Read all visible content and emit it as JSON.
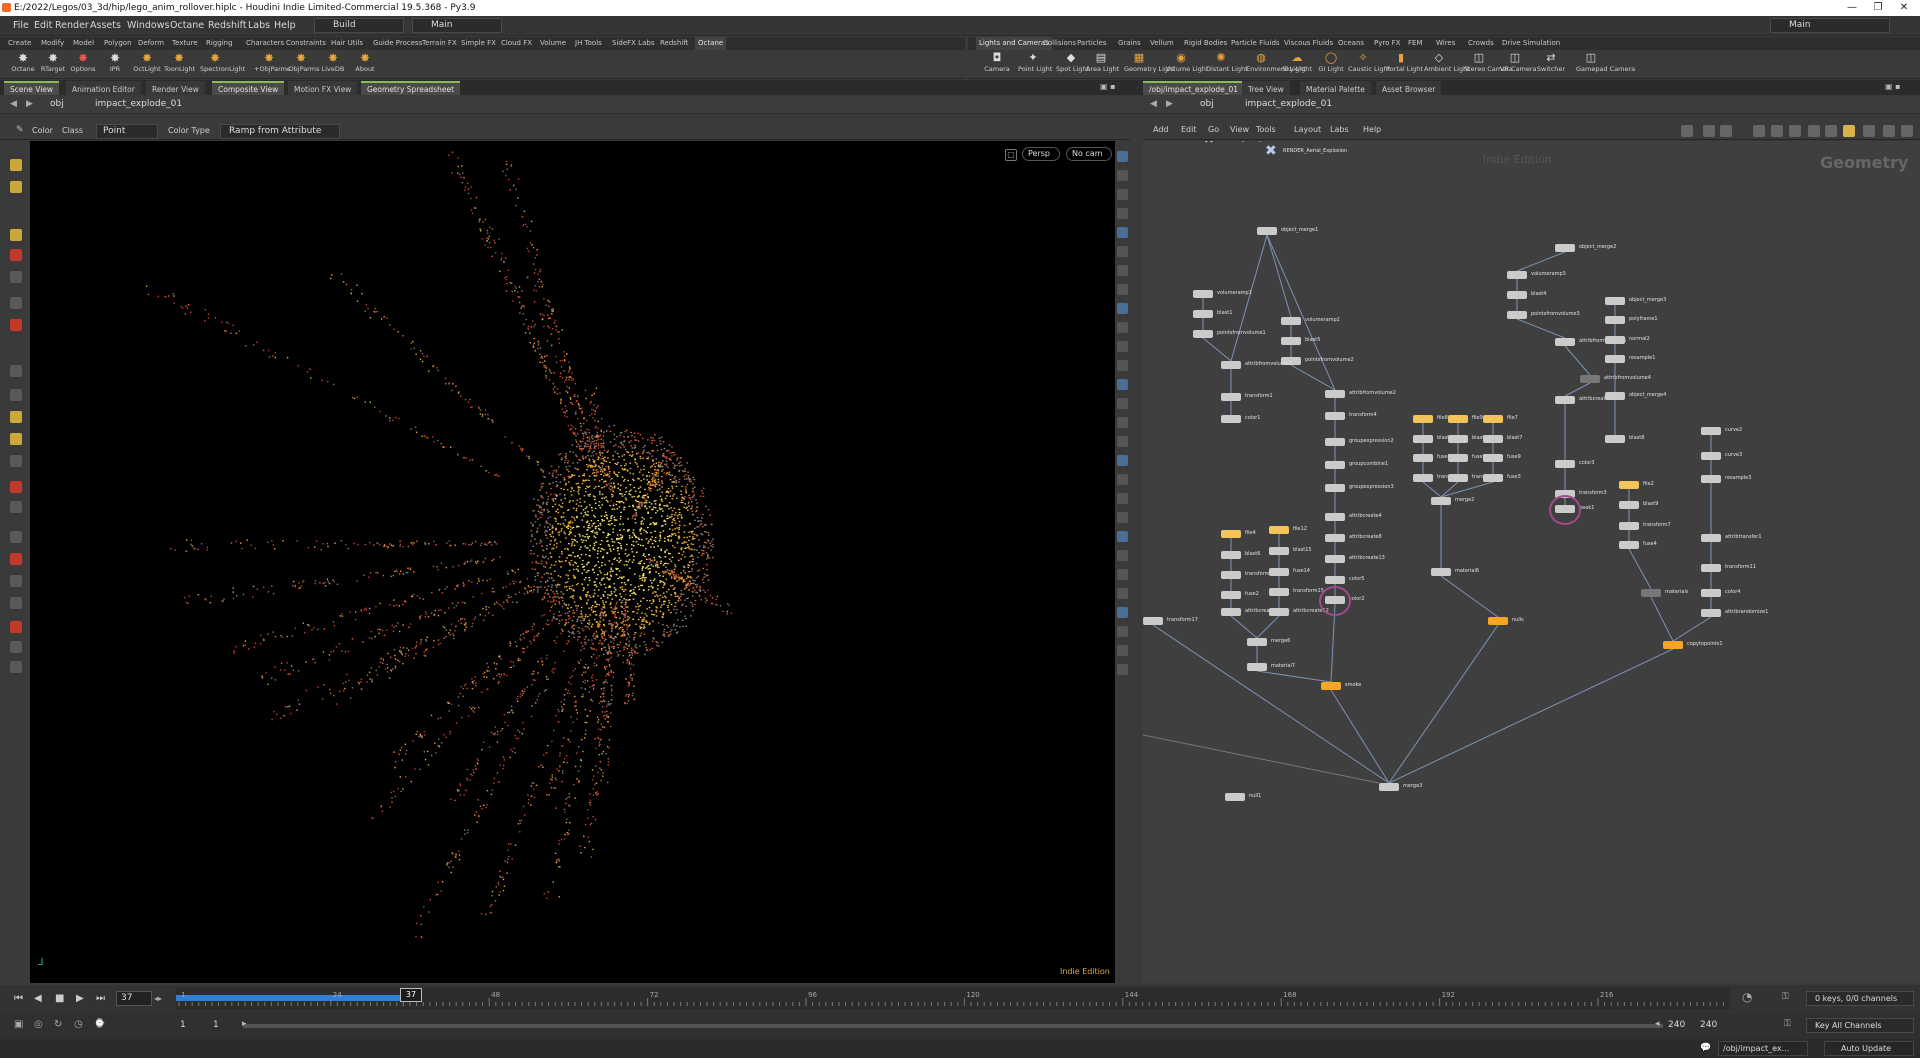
{
  "title_bar": {
    "text": "E:/2022/Legos/03_3d/hip/lego_anim_rollover.hiplc - Houdini Indie Limited-Commercial 19.5.368 - Py3.9",
    "minimize": "—",
    "restore": "❐",
    "close": "✕"
  },
  "menu": {
    "items": [
      "File",
      "Edit",
      "Render",
      "Assets",
      "Windows",
      "Octane",
      "Redshift",
      "Labs",
      "Help"
    ],
    "desktop": "Build",
    "context": "Main",
    "right_context": "Main"
  },
  "shelf_tabs_left": [
    "Create",
    "Modify",
    "Model",
    "Polygon",
    "Deform",
    "Texture",
    "Rigging",
    "Characters",
    "Constraints",
    "Hair Utils",
    "Guide Process",
    "Terrain FX",
    "Simple FX",
    "Cloud FX",
    "Volume",
    "JH Tools",
    "SideFX Labs",
    "Redshift",
    "Octane"
  ],
  "shelf_tabs_right": [
    "Lights and Cameras",
    "Collisions",
    "Particles",
    "Grains",
    "Vellum",
    "Rigid Bodies",
    "Particle Fluids",
    "Viscous Fluids",
    "Oceans",
    "Pyro FX",
    "FEM",
    "Wires",
    "Crowds",
    "Drive Simulation"
  ],
  "shelf_tools_left": [
    {
      "label": "Octane",
      "icon": "octane-icon"
    },
    {
      "label": "RTarget",
      "icon": "rtarget-icon"
    },
    {
      "label": "Options",
      "icon": "options-icon"
    },
    {
      "label": "IPR",
      "icon": "ipr-icon"
    },
    {
      "label": "OctLight",
      "icon": "octlight-icon"
    },
    {
      "label": "ToonLight",
      "icon": "toonlight-icon"
    },
    {
      "label": "SpectronLight",
      "icon": "spectronlight-icon"
    },
    {
      "label": "+ObjParms",
      "icon": "add-objparms-icon"
    },
    {
      "label": "-ObjParms",
      "icon": "remove-objparms-icon"
    },
    {
      "label": "LiveDB",
      "icon": "livedb-icon"
    },
    {
      "label": "About",
      "icon": "about-icon"
    }
  ],
  "shelf_tools_right": [
    {
      "label": "Camera",
      "icon": "camera-icon"
    },
    {
      "label": "Point Light",
      "icon": "point-light-icon"
    },
    {
      "label": "Spot Light",
      "icon": "spot-light-icon"
    },
    {
      "label": "Area Light",
      "icon": "area-light-icon"
    },
    {
      "label": "Geometry Light",
      "icon": "geometry-light-icon"
    },
    {
      "label": "Volume Light",
      "icon": "volume-light-icon"
    },
    {
      "label": "Distant Light",
      "icon": "distant-light-icon"
    },
    {
      "label": "Environment Light",
      "icon": "environment-light-icon"
    },
    {
      "label": "Sky Light",
      "icon": "sky-light-icon"
    },
    {
      "label": "GI Light",
      "icon": "gi-light-icon"
    },
    {
      "label": "Caustic Light",
      "icon": "caustic-light-icon"
    },
    {
      "label": "Portal Light",
      "icon": "portal-light-icon"
    },
    {
      "label": "Ambient Light",
      "icon": "ambient-light-icon"
    },
    {
      "label": "Stereo Camera",
      "icon": "stereo-camera-icon"
    },
    {
      "label": "VR Camera",
      "icon": "vr-camera-icon"
    },
    {
      "label": "Switcher",
      "icon": "switcher-icon"
    },
    {
      "label": "Gamepad Camera",
      "icon": "gamepad-camera-icon"
    }
  ],
  "pane_tabs_left": [
    "Scene View",
    "Animation Editor",
    "Render View",
    "Composite View",
    "Motion FX View",
    "Geometry Spreadsheet"
  ],
  "pane_tabs_right": [
    "/obj/impact_explode_01",
    "Tree View",
    "Material Palette",
    "Asset Browser"
  ],
  "path_left": {
    "root": "obj",
    "node": "impact_explode_01"
  },
  "path_right": {
    "root": "obj",
    "node": "impact_explode_01"
  },
  "viewport_opts": {
    "color": "Color",
    "class_label": "Class",
    "class_value": "Point",
    "color_type_label": "Color Type",
    "color_type_value": "Ramp from Attribute",
    "persp": "Persp",
    "cam": "No cam",
    "watermark": "Indie Edition"
  },
  "network_menu": [
    "Add",
    "Edit",
    "Go",
    "View",
    "Tools",
    "Layout",
    "Labs",
    "Help"
  ],
  "network": {
    "context_label": "Geometry",
    "partial_label": "Indie Edition",
    "render_nodes": [
      "RENDER_Aerial_Explosion",
      "RENDER_Aerial_Explosion"
    ],
    "nodes": [
      "object_merge1",
      "volumeramp1",
      "blast1",
      "pointsfromvolume1",
      "volumeramp2",
      "blast5",
      "pointsfromvolume2",
      "attribfromvolume1",
      "transform1",
      "color1",
      "attribfromvolume2",
      "transform4",
      "groupexpression2",
      "groupcombine1",
      "groupexpression3",
      "attribcreate4",
      "attribcreate8",
      "attribcreate13",
      "color5",
      "color2",
      "file4",
      "blast6",
      "transform2",
      "fuse2",
      "attribcreate11",
      "file12",
      "blast15",
      "fuse14",
      "transform15",
      "attribcreate12",
      "merge6",
      "material7",
      "smoke",
      "transform17",
      "file8",
      "file9",
      "file7",
      "blast10",
      "blast12",
      "blast7",
      "fuse8",
      "fuse10",
      "fuse9",
      "transform5",
      "transform6",
      "fuse3",
      "merge2",
      "material6",
      "nulls",
      "object_merge2",
      "volumeramp3",
      "blast4",
      "pointsfromvolume3",
      "attribfromvolume3",
      "object_merge3",
      "polyframe1",
      "normal2",
      "resample1",
      "attribfromvolume4",
      "attribcreate5",
      "object_merge4",
      "blast8",
      "color3",
      "transform3",
      "peak1",
      "file2",
      "blast9",
      "transform7",
      "fuse4",
      "materials",
      "curve2",
      "curve3",
      "resample3",
      "attribtransfer1",
      "transform11",
      "color4",
      "attribrandomize1",
      "copytopoints1",
      "merge3",
      "null1"
    ]
  },
  "timeline": {
    "current_frame": "37",
    "ticks": [
      "1",
      "24",
      "48",
      "72",
      "96",
      "120",
      "144",
      "168",
      "192",
      "216"
    ],
    "keys_info": "0 keys, 0/0 channels",
    "key_all_channels": "Key All Channels"
  },
  "range": {
    "start": "1",
    "start2": "1",
    "end": "240",
    "end2": "240"
  },
  "status": {
    "path": "/obj/impact_ex...",
    "auto_update": "Auto Update"
  },
  "colors": {
    "accent_green": "#8db856",
    "timeline_blue": "#2f7fd6",
    "node_yellow": "#f2c45a",
    "node_orange": "#f6a623"
  }
}
